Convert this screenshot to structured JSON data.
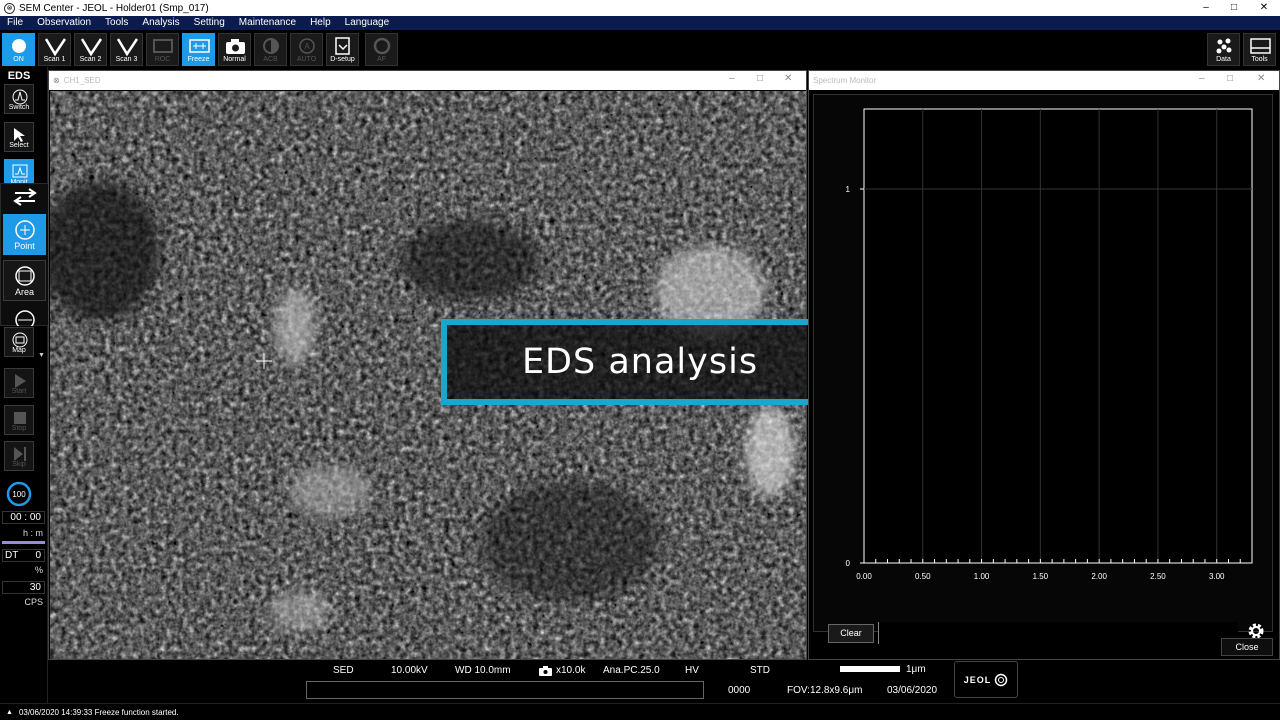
{
  "window": {
    "title": "SEM Center - JEOL - Holder01 (Smp_017)",
    "controls": [
      "–",
      "□",
      "✕"
    ]
  },
  "menu": [
    "File",
    "Observation",
    "Tools",
    "Analysis",
    "Setting",
    "Maintenance",
    "Help",
    "Language"
  ],
  "toolbar": {
    "on": "ON",
    "scan1": "Scan 1",
    "scan2": "Scan 2",
    "scan3": "Scan 3",
    "roc": "ROC",
    "freeze": "Freeze",
    "normal": "Normal",
    "acb": "ACB",
    "auto": "AUTO",
    "dsetup": "D-setup",
    "af": "AF",
    "data": "Data",
    "tools": "Tools"
  },
  "left_panel": {
    "title": "EDS",
    "switch": "Switch",
    "select": "Select",
    "monitor": "Monit",
    "point": "Point",
    "area": "Area",
    "map": "Map",
    "start": "Start",
    "stop": "Stop",
    "skip": "Skip",
    "progress": "100",
    "time": "00 : 00",
    "time_unit": "h : m",
    "dt_label": "DT",
    "dt_value": "0",
    "dt_unit": "%",
    "cps_value": "30",
    "cps_unit": "CPS"
  },
  "image_window": {
    "title": "CH1_SED"
  },
  "caption": "EDS analysis",
  "spectrum_window": {
    "title": "Spectrum Monitor",
    "clear": "Clear",
    "close": "Close"
  },
  "chart_data": {
    "type": "line",
    "title": "",
    "xlabel": "",
    "ylabel": "",
    "xlim": [
      0,
      3.3
    ],
    "ylim": [
      0,
      1
    ],
    "x_ticks": [
      "0.00",
      "0.50",
      "1.00",
      "1.50",
      "2.00",
      "2.50",
      "3.00"
    ],
    "y_ticks": [
      "0",
      "1"
    ],
    "series": [],
    "grid": true
  },
  "status": {
    "detector": "SED",
    "voltage": "10.00kV",
    "wd": "WD 10.0mm",
    "mag": "x10.0k",
    "pc": "Ana.PC.25.0",
    "vacuum": "HV",
    "mode": "STD",
    "scale": "1μm",
    "counter": "0000",
    "fov": "FOV:12.8x9.6μm",
    "date": "03/06/2020",
    "logo": "JEOL"
  },
  "message": "03/06/2020 14:39:33 Freeze function started.",
  "colors": {
    "accent": "#1e9be8",
    "caption_border": "#1aa7c9",
    "menubar": "#0b1b4d"
  }
}
